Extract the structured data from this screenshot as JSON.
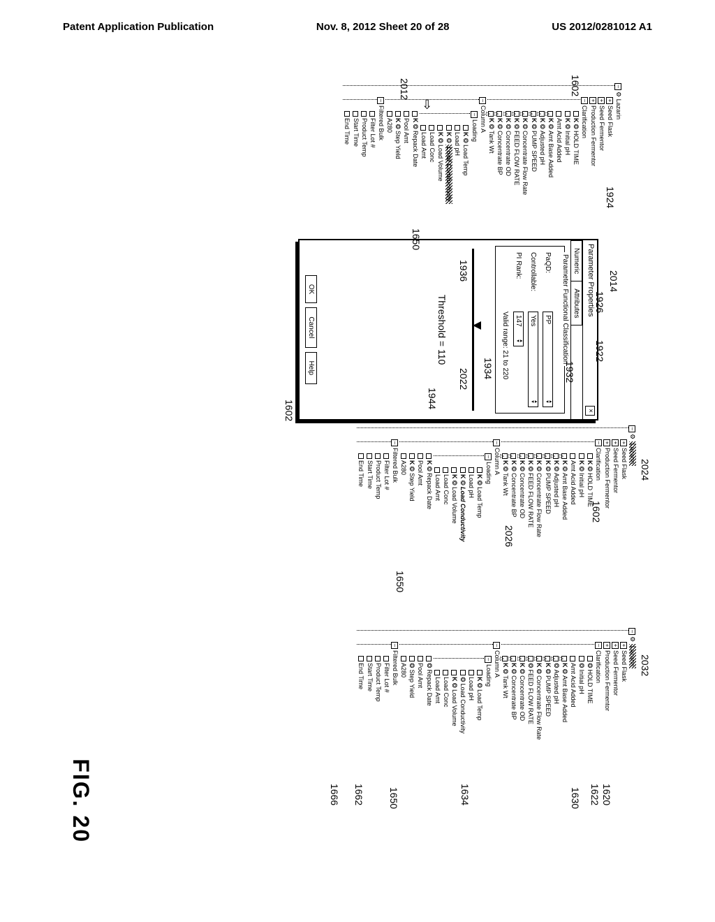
{
  "header": {
    "left": "Patent Application Publication",
    "center": "Nov. 8, 2012  Sheet 20 of 28",
    "right": "US 2012/0281012 A1"
  },
  "figure_label": "FIG. 20",
  "callouts": {
    "c2014": "2014",
    "c1924": "1924",
    "c1926": "1926",
    "c1922": "1922",
    "c1932": "1932",
    "c1934": "1934",
    "c1936": "1936",
    "c1944": "1944",
    "c2012": "2012",
    "c2022": "2022",
    "c2024": "2024",
    "c2026": "2026",
    "c2032": "2032",
    "c1602a": "1602",
    "c1602b": "1602",
    "c1602c": "1602",
    "c1650a": "1650",
    "c1650b": "1650",
    "c1650c": "1650",
    "c1620": "1620",
    "c1622": "1622",
    "c1630": "1630",
    "c1634": "1634",
    "c1662": "1662",
    "c1666": "1666"
  },
  "tree": {
    "root": "Lazarin",
    "seed_flask": "Seed Flask",
    "seed_fermentor": "Seed Fermentor",
    "prod_fermentor": "Production Fermentor",
    "clarification": "Clarification",
    "hold_time": "HOLD TIME",
    "initial_ph": "Initial pH",
    "amt_acid": "Amt Acid Added",
    "amt_base": "Amt Base Added",
    "adjusted_ph": "Adjusted pH",
    "pump_speed": "PUMP SPEED",
    "conc_flow_rate": "Concentrate Flow Rate",
    "feed_flow_rate": "FEED FLOW RATE",
    "conc_od": "Concentrate OD",
    "conc_bp": "Concentrate BP",
    "tank_wt": "Tank Wt",
    "column_a": "Column A",
    "loading": "Loading",
    "load_temp": "Load Temp",
    "load_ph": "Load pH",
    "load_conductivity": "Load Conductivity",
    "load_volume": "Load Volume",
    "load_conc": "Load Conc",
    "load_amt": "Load Amt",
    "repack_date": "Repack Date",
    "pool_amt": "Pool Amt",
    "step_yield": "Step Yield",
    "a280": "A280",
    "filtered_bulk": "Filtered Bulk",
    "filter_lot": "Filter Lot #",
    "product_temp": "Product Temp",
    "start_time": "Start Time",
    "end_time": "End Time"
  },
  "dialog": {
    "title": "Parameter Properties",
    "tabs": {
      "numeric": "Numeric",
      "attributes": "Attributes"
    },
    "group_title": "Parameter Functional Classification",
    "paqd_label": "PaQD:",
    "paqd_value": "PP",
    "controllable_label": "Controllable:",
    "controllable_value": "Yes",
    "pirank_label": "PI Rank:",
    "pirank_value": "147",
    "range_prefix": "Valid range:",
    "range_low": "21",
    "range_to": "to",
    "range_high": "220",
    "threshold_label": "Threshold",
    "threshold_eq": "=",
    "threshold_value": "110",
    "buttons": {
      "ok": "OK",
      "cancel": "Cancel",
      "help": "Help"
    }
  }
}
